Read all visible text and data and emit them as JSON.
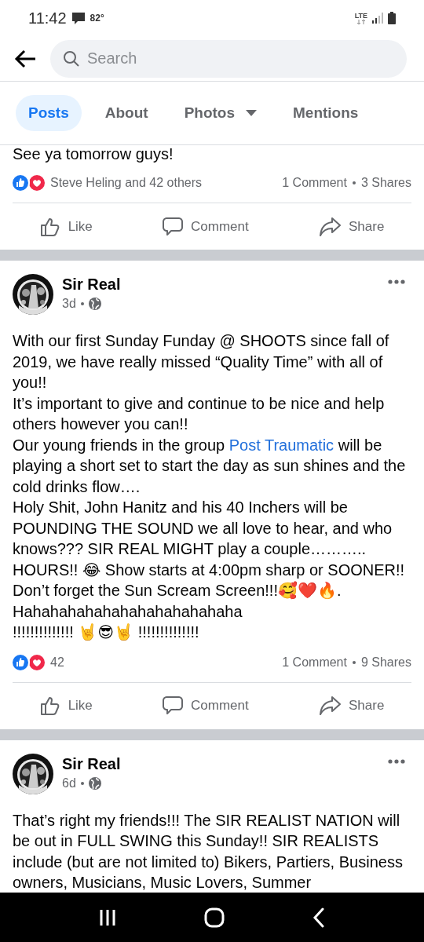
{
  "status_bar": {
    "time": "11:42",
    "temperature": "82°",
    "network": "LTE"
  },
  "search": {
    "placeholder": "Search"
  },
  "tabs": [
    {
      "label": "Posts",
      "selected": true,
      "dropdown": false
    },
    {
      "label": "About",
      "selected": false,
      "dropdown": false
    },
    {
      "label": "Photos",
      "selected": false,
      "dropdown": true
    },
    {
      "label": "Mentions",
      "selected": false,
      "dropdown": false
    }
  ],
  "posts": [
    {
      "kind": "partial",
      "body": [
        {
          "parts": [
            {
              "kind": "text",
              "text": "See ya tomorrow guys!"
            }
          ]
        }
      ],
      "reactions": {
        "summary": "Steve Heling and 42 others",
        "comments": "1 Comment",
        "shares": "3 Shares"
      },
      "actions": [
        {
          "kind": "like",
          "label": "Like"
        },
        {
          "kind": "comment",
          "label": "Comment"
        },
        {
          "kind": "share",
          "label": "Share"
        }
      ]
    },
    {
      "kind": "full",
      "author": "Sir Real",
      "time": "3d",
      "body": [
        {
          "parts": [
            {
              "kind": "text",
              "text": "With our first Sunday Funday @ SHOOTS since fall of 2019, we have really missed “Quality Time” with all of you!!"
            }
          ]
        },
        {
          "parts": [
            {
              "kind": "text",
              "text": "It’s important to give and continue to be nice and help others however you can!!"
            }
          ]
        },
        {
          "parts": [
            {
              "kind": "text",
              "text": "Our young friends in the group "
            },
            {
              "kind": "link",
              "text": "Post Traumatic"
            },
            {
              "kind": "text",
              "text": " will be playing a short set to start the day as sun shines and the cold drinks flow…."
            }
          ]
        },
        {
          "parts": [
            {
              "kind": "text",
              "text": "Holy Shit, John Hanitz and his 40 Inchers will be POUNDING THE SOUND we all love to hear, and who knows??? SIR REAL MIGHT play a couple……….. HOURS!! 😂 Show starts at 4:00pm sharp or SOONER!!"
            }
          ]
        },
        {
          "parts": [
            {
              "kind": "text",
              "text": "Don’t forget the Sun Scream Screen!!!🥰❤️🔥."
            }
          ]
        },
        {
          "parts": [
            {
              "kind": "text",
              "text": "Hahahahahahahahahahahahaha"
            }
          ]
        },
        {
          "parts": [
            {
              "kind": "text",
              "text": "!!!!!!!!!!!!!! 🤘😎🤘 !!!!!!!!!!!!!!"
            }
          ]
        }
      ],
      "reactions": {
        "summary": "42",
        "comments": "1 Comment",
        "shares": "9 Shares"
      },
      "actions": [
        {
          "kind": "like",
          "label": "Like"
        },
        {
          "kind": "comment",
          "label": "Comment"
        },
        {
          "kind": "share",
          "label": "Share"
        }
      ]
    },
    {
      "kind": "full",
      "author": "Sir Real",
      "time": "6d",
      "body": [
        {
          "parts": [
            {
              "kind": "text",
              "text": "That’s right my friends!!! The SIR REALIST NATION will be out in FULL SWING this Sunday!! SIR REALISTS include (but are not limited to) Bikers, Partiers, Business owners, Musicians, Music Lovers, Summer"
            }
          ]
        }
      ]
    }
  ]
}
